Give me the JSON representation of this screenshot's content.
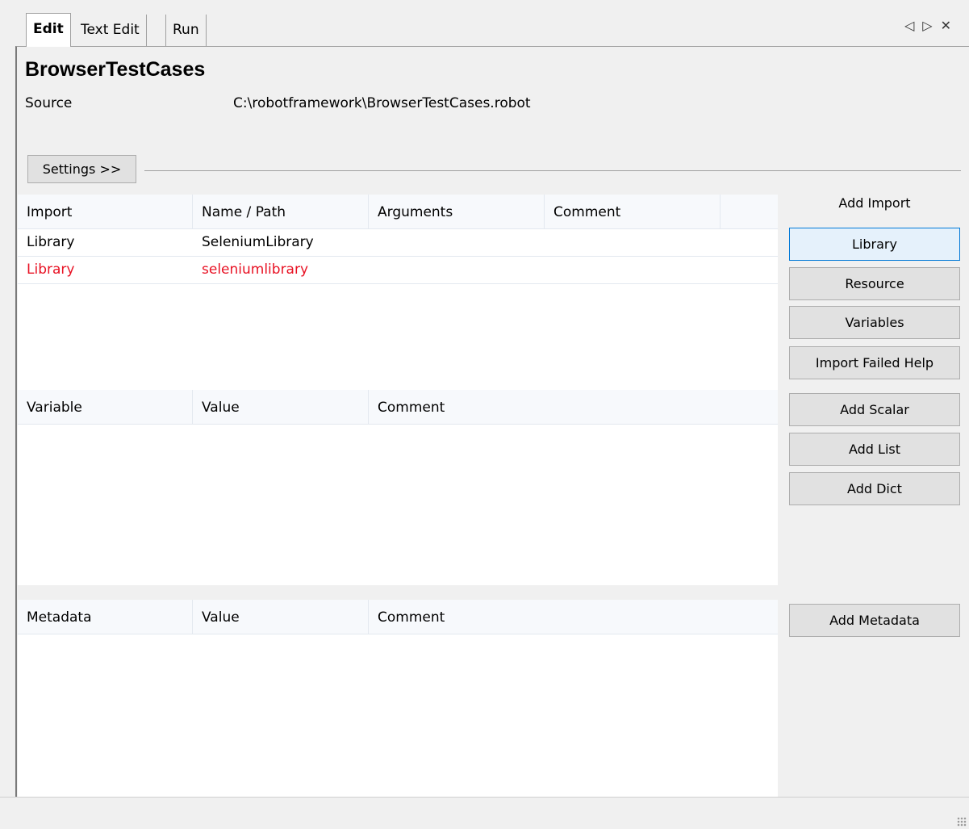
{
  "tabs": [
    {
      "label": "Edit",
      "active": true
    },
    {
      "label": "Text Edit",
      "active": false
    },
    {
      "label": "Run",
      "active": false
    }
  ],
  "nav": {
    "prev": "◁",
    "next": "▷",
    "close": "✕"
  },
  "suite": {
    "title": "BrowserTestCases",
    "source_label": "Source",
    "source_value": "C:\\robotframework\\BrowserTestCases.robot"
  },
  "settings_button": "Settings >>",
  "imports": {
    "headers": [
      "Import",
      "Name / Path",
      "Arguments",
      "Comment"
    ],
    "rows": [
      {
        "import": "Library",
        "name": "SeleniumLibrary",
        "error": false
      },
      {
        "import": "Library",
        "name": "seleniumlibrary",
        "error": true
      }
    ]
  },
  "variables": {
    "headers": [
      "Variable",
      "Value",
      "Comment"
    ]
  },
  "metadata": {
    "headers": [
      "Metadata",
      "Value",
      "Comment"
    ]
  },
  "side": {
    "add_import_label": "Add Import",
    "library": "Library",
    "resource": "Resource",
    "variables": "Variables",
    "import_failed_help": "Import Failed Help",
    "add_scalar": "Add Scalar",
    "add_list": "Add List",
    "add_dict": "Add Dict",
    "add_metadata": "Add Metadata"
  },
  "colors": {
    "error_text": "#e81123",
    "focus_border": "#0078d7"
  }
}
